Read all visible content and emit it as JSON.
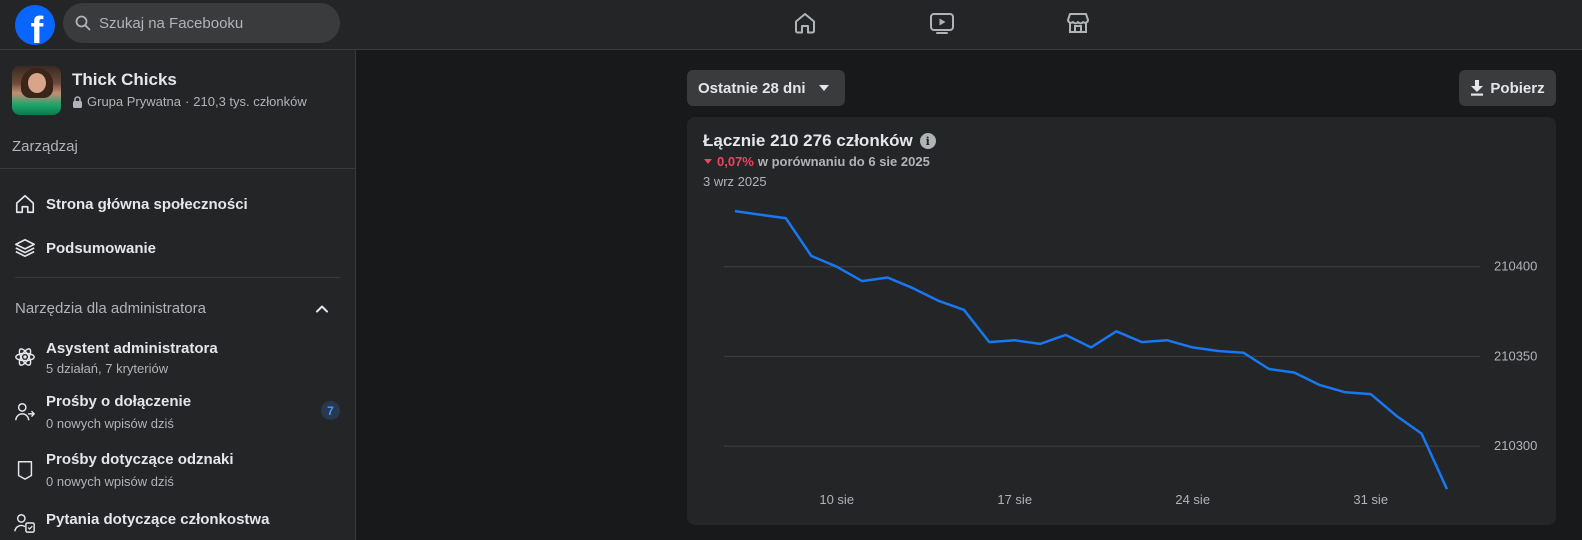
{
  "topbar": {
    "logo_letter": "f",
    "search_placeholder": "Szukaj na Facebooku",
    "nav_icons": [
      "home-icon",
      "video-icon",
      "marketplace-icon"
    ]
  },
  "sidebar": {
    "group": {
      "name": "Thick Chicks",
      "privacy": "Grupa Prywatna",
      "members": "210,3 tys. członków"
    },
    "manage_label": "Zarządzaj",
    "items": [
      {
        "label": "Strona główna społeczności",
        "icon": "home-icon"
      },
      {
        "label": "Podsumowanie",
        "icon": "layers-icon"
      }
    ],
    "admin_tools": {
      "title": "Narzędzia dla administratora",
      "items": [
        {
          "label": "Asystent administratora",
          "sub": "5 działań, 7 kryteriów",
          "icon": "atom-icon"
        },
        {
          "label": "Prośby o dołączenie",
          "sub": "0 nowych wpisów dziś",
          "icon": "person-add-icon",
          "badge": "7"
        },
        {
          "label": "Prośby dotyczące odznaki",
          "sub": "0 nowych wpisów dziś",
          "icon": "badge-icon"
        },
        {
          "label": "Pytania dotyczące członkostwa",
          "icon": "member-questions-icon"
        }
      ]
    }
  },
  "main": {
    "range_label": "Ostatnie 28 dni",
    "download_label": "Pobierz",
    "card": {
      "title": "Łącznie 210 276 członków",
      "change_pct": "0,07%",
      "change_text": "w porównaniu do 6 sie 2025",
      "date": "3 wrz 2025"
    }
  },
  "colors": {
    "accent": "#0866ff",
    "line": "#1877f2",
    "negative": "#f3425f",
    "background": "#18191a",
    "surface": "#242526"
  },
  "chart_data": {
    "type": "line",
    "x": [
      "6 sie",
      "7 sie",
      "8 sie",
      "9 sie",
      "10 sie",
      "11 sie",
      "12 sie",
      "13 sie",
      "14 sie",
      "15 sie",
      "16 sie",
      "17 sie",
      "18 sie",
      "19 sie",
      "20 sie",
      "21 sie",
      "22 sie",
      "23 sie",
      "24 sie",
      "25 sie",
      "26 sie",
      "27 sie",
      "28 sie",
      "29 sie",
      "30 sie",
      "31 sie",
      "1 wrz",
      "2 wrz",
      "3 wrz"
    ],
    "series": [
      {
        "values": [
          210431,
          210429,
          210427,
          210406,
          210400,
          210392,
          210394,
          210388,
          210381,
          210376,
          210358,
          210359,
          210357,
          210362,
          210355,
          210364,
          210358,
          210359,
          210355,
          210353,
          210352,
          210343,
          210341,
          210334,
          210330,
          210329,
          210317,
          210307,
          210276
        ]
      }
    ],
    "xticks": [
      "10 sie",
      "17 sie",
      "24 sie",
      "31 sie"
    ],
    "yticks": [
      210300,
      210350,
      210400
    ],
    "ylim": [
      210280,
      210450
    ],
    "grid": true,
    "y_axis_side": "right"
  }
}
